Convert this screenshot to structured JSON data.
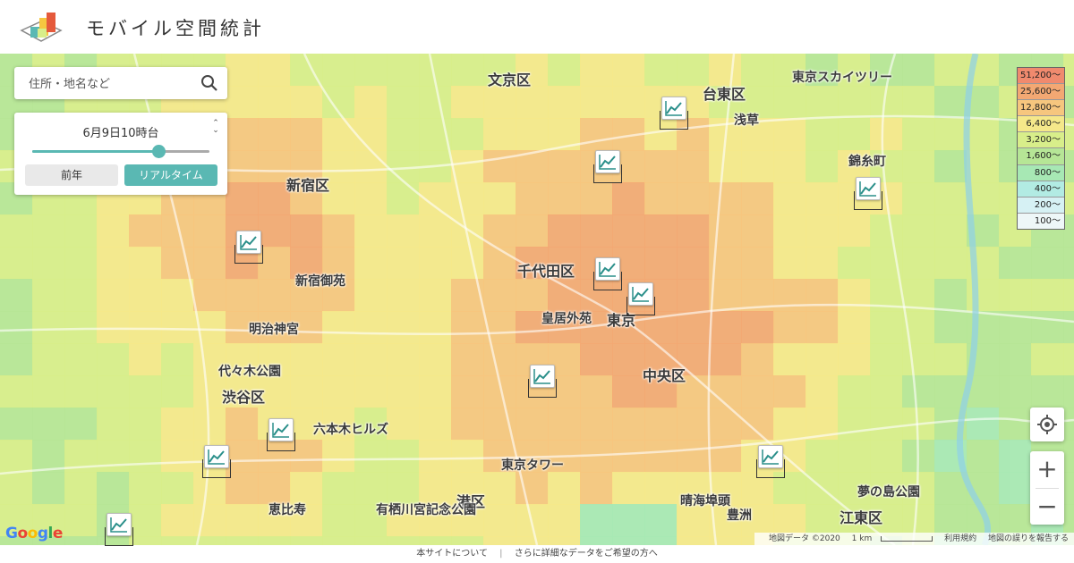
{
  "app": {
    "title": "モバイル空間統計"
  },
  "search": {
    "placeholder": "住所・地名など"
  },
  "time_control": {
    "label": "6月9日10時台",
    "slider_fraction": 0.71,
    "prev_year_label": "前年",
    "realtime_label": "リアルタイム"
  },
  "legend": {
    "items": [
      {
        "label": "51,200〜",
        "color": "#f08a6e"
      },
      {
        "label": "25,600〜",
        "color": "#f3a873"
      },
      {
        "label": "12,800〜",
        "color": "#f6c67e"
      },
      {
        "label": "6,400〜",
        "color": "#f5e88a"
      },
      {
        "label": "3,200〜",
        "color": "#d8ee8a"
      },
      {
        "label": "1,600〜",
        "color": "#b6e696"
      },
      {
        "label": "800〜",
        "color": "#a7e8b4"
      },
      {
        "label": "400〜",
        "color": "#b2ebe3"
      },
      {
        "label": "200〜",
        "color": "#d6f1f4"
      },
      {
        "label": "100〜",
        "color": "#eef7f8"
      }
    ]
  },
  "map": {
    "labels": [
      {
        "text": "文京区",
        "kind": "area"
      },
      {
        "text": "台東区",
        "kind": "area"
      },
      {
        "text": "新宿区",
        "kind": "area"
      },
      {
        "text": "千代田区",
        "kind": "area"
      },
      {
        "text": "渋谷区",
        "kind": "area"
      },
      {
        "text": "中央区",
        "kind": "area"
      },
      {
        "text": "港区",
        "kind": "area"
      },
      {
        "text": "江東区",
        "kind": "area"
      },
      {
        "text": "東京",
        "kind": "place"
      },
      {
        "text": "東京スカイツリー",
        "kind": "place"
      },
      {
        "text": "浅草",
        "kind": "place"
      },
      {
        "text": "新宿御苑",
        "kind": "place"
      },
      {
        "text": "皇居外苑",
        "kind": "place"
      },
      {
        "text": "明治神宮",
        "kind": "place"
      },
      {
        "text": "東京タワー",
        "kind": "place"
      },
      {
        "text": "代々木公園",
        "kind": "place"
      },
      {
        "text": "有栖川宮記念公園",
        "kind": "place"
      },
      {
        "text": "晴海埠頭",
        "kind": "place"
      },
      {
        "text": "夢の島公園",
        "kind": "place"
      },
      {
        "text": "豊洲",
        "kind": "place"
      },
      {
        "text": "錦糸町",
        "kind": "place"
      },
      {
        "text": "六本木ヒルズ",
        "kind": "place"
      },
      {
        "text": "恵比寿",
        "kind": "place"
      }
    ]
  },
  "controls": {
    "location_icon": "crosshair-icon",
    "zoom_in": "+",
    "zoom_out": "−"
  },
  "attribution": {
    "google": "Google",
    "map_data": "地図データ ©2020",
    "scale": "1 km",
    "terms": "利用規約",
    "report": "地図の誤りを報告する"
  },
  "footer": {
    "about": "本サイトについて",
    "sep": "|",
    "detail": "さらに詳細なデータをご希望の方へ"
  }
}
